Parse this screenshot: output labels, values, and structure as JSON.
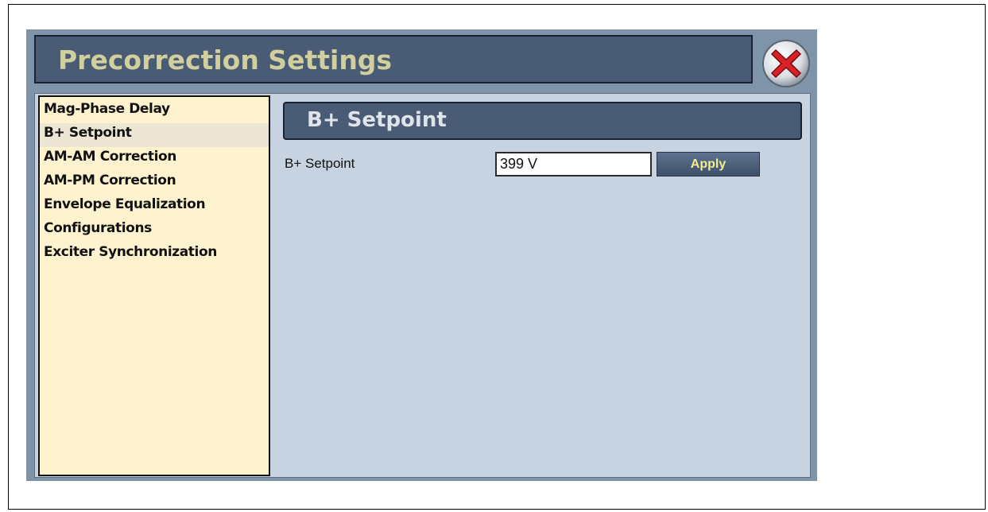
{
  "window": {
    "title": "Precorrection Settings",
    "close_icon": "close-x-icon"
  },
  "nav": {
    "items": [
      {
        "label": "Mag-Phase Delay",
        "selected": false
      },
      {
        "label": "B+ Setpoint",
        "selected": true
      },
      {
        "label": "AM-AM Correction",
        "selected": false
      },
      {
        "label": "AM-PM Correction",
        "selected": false
      },
      {
        "label": "Envelope Equalization",
        "selected": false
      },
      {
        "label": "Configurations",
        "selected": false
      },
      {
        "label": "Exciter Synchronization",
        "selected": false
      }
    ]
  },
  "section": {
    "title": "B+ Setpoint"
  },
  "setpoint": {
    "label": "B+ Setpoint",
    "value": "399 V",
    "apply_label": "Apply"
  },
  "colors": {
    "title_bar": "#4a5c75",
    "title_text": "#d2cf9f",
    "nav_background": "#fff3cf",
    "content_background": "#c7d3e1",
    "apply_text": "#f2ef8a",
    "close_red": "#d8222a"
  }
}
